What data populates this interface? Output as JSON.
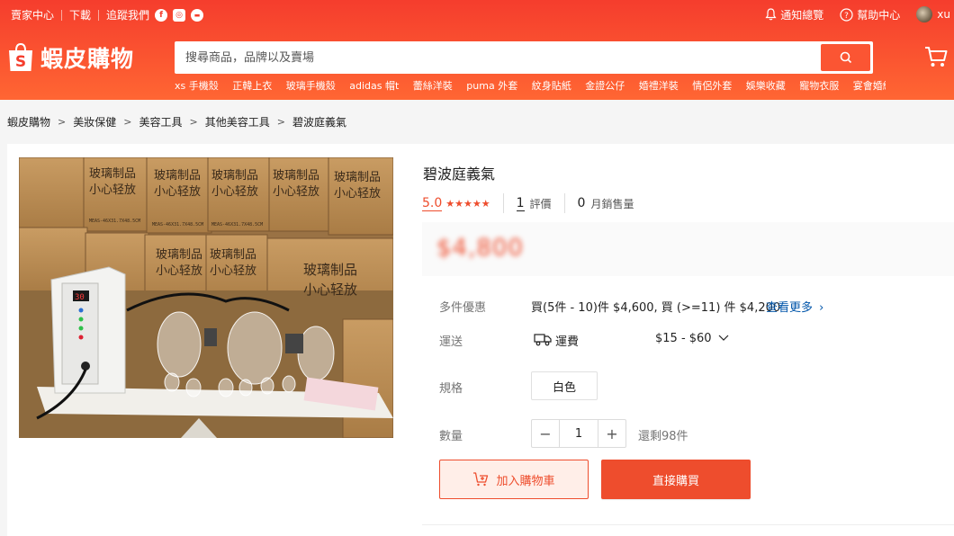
{
  "topbar": {
    "seller_center": "賣家中心",
    "download": "下載",
    "follow_us": "追蹤我們",
    "notifications": "通知總覽",
    "help": "幫助中心",
    "username": "xu"
  },
  "brand": {
    "name": "蝦皮購物",
    "logo_letter": "S",
    "accent": "#ee4d2d"
  },
  "search": {
    "placeholder": "搜尋商品，品牌以及賣場",
    "hot_words": [
      "xs 手機殼",
      "正韓上衣",
      "玻璃手機殼",
      "adidas 帽t",
      "蕾絲洋裝",
      "puma 外套",
      "紋身貼紙",
      "金證公仔",
      "婚禮洋裝",
      "情侶外套",
      "娛樂收藏",
      "寵物衣服",
      "宴會婚紗"
    ]
  },
  "breadcrumb": [
    "蝦皮購物",
    "美妝保健",
    "美容工具",
    "其他美容工具",
    "碧波庭義氣"
  ],
  "product": {
    "title": "碧波庭義氣",
    "rating": "5.0",
    "stars": "★★★★★",
    "review_count": "1",
    "review_label": "評價",
    "sold_count": "0",
    "sold_label": "月銷售量",
    "price": "$4,800",
    "bulk_label": "多件優惠",
    "bulk_text": "買(5件 - 10)件 $4,600, 買 (>=11) 件 $4,200",
    "see_more": "查看更多",
    "shipping_label": "運送",
    "shipping_fee_label": "運費",
    "shipping_fee": "$15 - $60",
    "variant_label": "規格",
    "variant_option": "白色",
    "qty_label": "數量",
    "qty_value": "1",
    "qty_minus": "−",
    "qty_plus": "+",
    "stock_text": "還剩98件",
    "add_to_cart": "加入購物車",
    "buy_now": "直接購買"
  },
  "photo": {
    "box_text_1": "玻璃制品",
    "box_text_2": "小心轻放",
    "box_code": "MEAS-46X31.7X48.5CM",
    "device_display": "30"
  }
}
